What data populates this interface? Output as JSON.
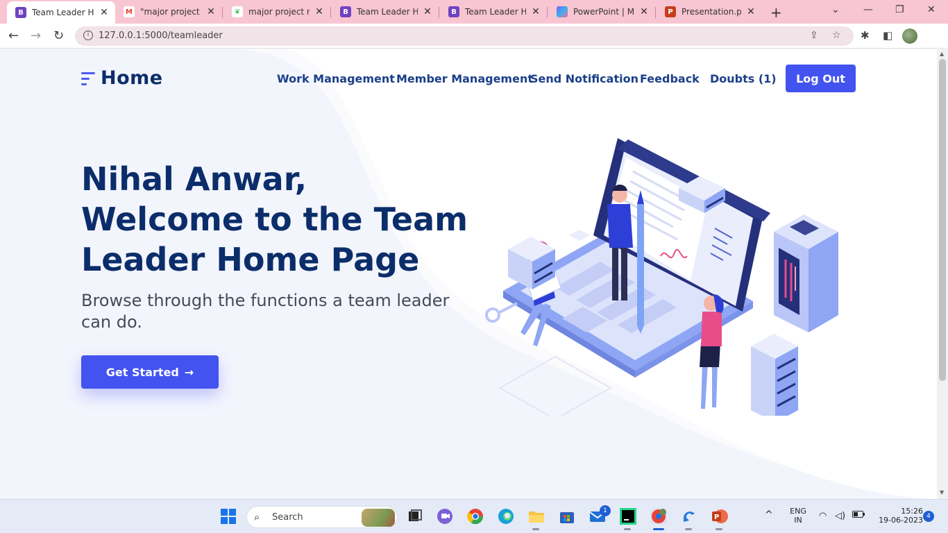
{
  "browser": {
    "tabs": [
      {
        "title": "Team Leader Hon",
        "favicon": "B",
        "favicon_color": "#6f42c1",
        "active": true
      },
      {
        "title": "\"major project rep",
        "favicon": "M",
        "favicon_color": "#ea4335",
        "active": false
      },
      {
        "title": "major project rep",
        "favicon": "S",
        "favicon_color": "#3bbf62",
        "active": false
      },
      {
        "title": "Team Leader Hon",
        "favicon": "B",
        "favicon_color": "#6f42c1",
        "active": false
      },
      {
        "title": "Team Leader Hon",
        "favicon": "B",
        "favicon_color": "#6f42c1",
        "active": false
      },
      {
        "title": "PowerPoint | Mic",
        "favicon": "O",
        "favicon_color": "#3b6fe8",
        "active": false
      },
      {
        "title": "Presentation.pptx",
        "favicon": "P",
        "favicon_color": "#c43e1c",
        "active": false
      }
    ],
    "close_glyph": "✕",
    "new_tab_glyph": "+",
    "url": "127.0.0.1:5000/teamleader"
  },
  "page": {
    "brand": "Home",
    "nav": {
      "work": "Work Management",
      "member": "Member Management",
      "notify": "Send Notification",
      "feedback": "Feedback",
      "doubts": "Doubts (1)"
    },
    "logout": "Log Out",
    "hero": {
      "title": "Nihal Anwar, Welcome to the Team Leader Home Page",
      "subtitle": "Browse through the functions a team leader can do.",
      "cta": "Get Started",
      "cta_arrow": "→"
    }
  },
  "taskbar": {
    "search_placeholder": "Search",
    "mail_badge": "1",
    "lang": "ENG",
    "region": "IN",
    "time": "15:26",
    "date": "19-06-2023",
    "notifications": "4"
  },
  "colors": {
    "accent": "#4353f0",
    "heading": "#0b2d6a",
    "tabbar": "#f8c5d2"
  }
}
